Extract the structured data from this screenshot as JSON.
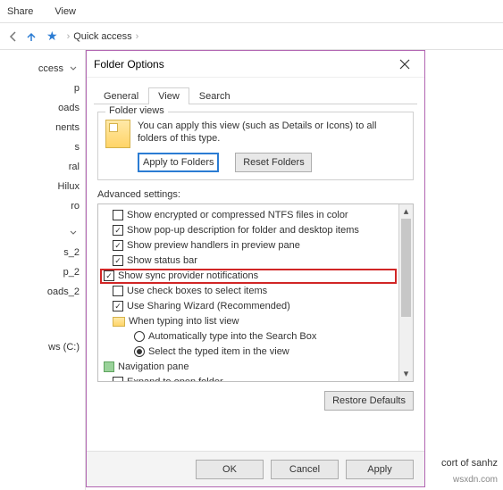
{
  "menu": {
    "share": "Share",
    "view": "View"
  },
  "nav": {
    "quick_access": "Quick access"
  },
  "tree": {
    "items": [
      "ccess",
      "p",
      "oads",
      "nents",
      "s",
      "ral",
      "Hilux",
      "ro",
      "s_2",
      "p_2",
      "oads_2",
      "ws (C:)"
    ]
  },
  "dialog": {
    "title": "Folder Options",
    "tabs": {
      "general": "General",
      "view": "View",
      "search": "Search"
    },
    "folder_views": {
      "legend": "Folder views",
      "text": "You can apply this view (such as Details or Icons) to all folders of this type.",
      "apply": "Apply to Folders",
      "reset": "Reset Folders"
    },
    "advanced_label": "Advanced settings:",
    "adv": {
      "r0": "Show encrypted or compressed NTFS files in color",
      "r1": "Show pop-up description for folder and desktop items",
      "r2": "Show preview handlers in preview pane",
      "r3": "Show status bar",
      "r4": "Show sync provider notifications",
      "r5": "Use check boxes to select items",
      "r6": "Use Sharing Wizard (Recommended)",
      "r7": "When typing into list view",
      "r8": "Automatically type into the Search Box",
      "r9": "Select the typed item in the view",
      "r10": "Navigation pane",
      "r11": "Expand to open folder"
    },
    "restore": "Restore Defaults",
    "ok": "OK",
    "cancel": "Cancel",
    "apply": "Apply"
  },
  "corner": "cort of sanhz",
  "watermark": "wsxdn.com"
}
